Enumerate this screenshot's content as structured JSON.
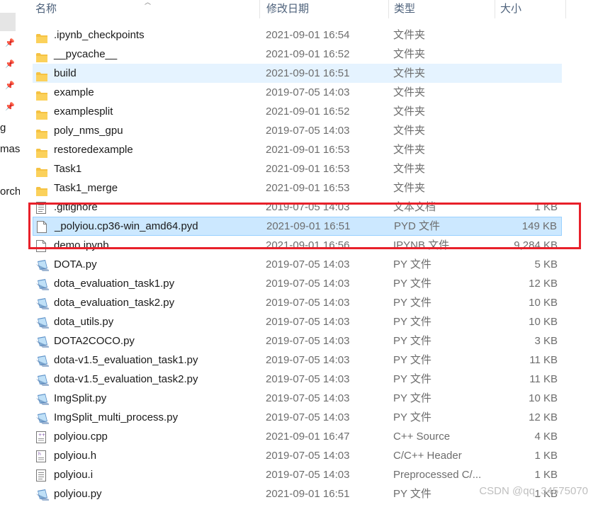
{
  "columns": {
    "name": "名称",
    "modified": "修改日期",
    "type": "类型",
    "size": "大小"
  },
  "nav_fragments": [
    "g",
    "mas",
    "orch"
  ],
  "files": [
    {
      "name": ".ipynb_checkpoints",
      "modified": "2021-09-01 16:54",
      "type": "文件夹",
      "size": "",
      "icon": "folder-icon",
      "state": ""
    },
    {
      "name": "__pycache__",
      "modified": "2021-09-01 16:52",
      "type": "文件夹",
      "size": "",
      "icon": "folder-icon",
      "state": ""
    },
    {
      "name": "build",
      "modified": "2021-09-01 16:51",
      "type": "文件夹",
      "size": "",
      "icon": "folder-icon",
      "state": "hover"
    },
    {
      "name": "example",
      "modified": "2019-07-05 14:03",
      "type": "文件夹",
      "size": "",
      "icon": "folder-icon",
      "state": ""
    },
    {
      "name": "examplesplit",
      "modified": "2021-09-01 16:52",
      "type": "文件夹",
      "size": "",
      "icon": "folder-icon",
      "state": ""
    },
    {
      "name": "poly_nms_gpu",
      "modified": "2019-07-05 14:03",
      "type": "文件夹",
      "size": "",
      "icon": "folder-icon",
      "state": ""
    },
    {
      "name": "restoredexample",
      "modified": "2021-09-01 16:53",
      "type": "文件夹",
      "size": "",
      "icon": "folder-icon",
      "state": ""
    },
    {
      "name": "Task1",
      "modified": "2021-09-01 16:53",
      "type": "文件夹",
      "size": "",
      "icon": "folder-icon",
      "state": ""
    },
    {
      "name": "Task1_merge",
      "modified": "2021-09-01 16:53",
      "type": "文件夹",
      "size": "",
      "icon": "folder-icon",
      "state": ""
    },
    {
      "name": ".gitignore",
      "modified": "2019-07-05 14:03",
      "type": "文本文档",
      "size": "1 KB",
      "icon": "text-file-icon",
      "state": ""
    },
    {
      "name": "_polyiou.cp36-win_amd64.pyd",
      "modified": "2021-09-01 16:51",
      "type": "PYD 文件",
      "size": "149 KB",
      "icon": "file-icon",
      "state": "selected"
    },
    {
      "name": "demo.ipynb",
      "modified": "2021-09-01 16:56",
      "type": "IPYNB 文件",
      "size": "9,284 KB",
      "icon": "file-icon",
      "state": ""
    },
    {
      "name": "DOTA.py",
      "modified": "2019-07-05 14:03",
      "type": "PY 文件",
      "size": "5 KB",
      "icon": "python-file-icon",
      "state": ""
    },
    {
      "name": "dota_evaluation_task1.py",
      "modified": "2019-07-05 14:03",
      "type": "PY 文件",
      "size": "12 KB",
      "icon": "python-file-icon",
      "state": ""
    },
    {
      "name": "dota_evaluation_task2.py",
      "modified": "2019-07-05 14:03",
      "type": "PY 文件",
      "size": "10 KB",
      "icon": "python-file-icon",
      "state": ""
    },
    {
      "name": "dota_utils.py",
      "modified": "2019-07-05 14:03",
      "type": "PY 文件",
      "size": "10 KB",
      "icon": "python-file-icon",
      "state": ""
    },
    {
      "name": "DOTA2COCO.py",
      "modified": "2019-07-05 14:03",
      "type": "PY 文件",
      "size": "3 KB",
      "icon": "python-file-icon",
      "state": ""
    },
    {
      "name": "dota-v1.5_evaluation_task1.py",
      "modified": "2019-07-05 14:03",
      "type": "PY 文件",
      "size": "11 KB",
      "icon": "python-file-icon",
      "state": ""
    },
    {
      "name": "dota-v1.5_evaluation_task2.py",
      "modified": "2019-07-05 14:03",
      "type": "PY 文件",
      "size": "11 KB",
      "icon": "python-file-icon",
      "state": ""
    },
    {
      "name": "ImgSplit.py",
      "modified": "2019-07-05 14:03",
      "type": "PY 文件",
      "size": "10 KB",
      "icon": "python-file-icon",
      "state": ""
    },
    {
      "name": "ImgSplit_multi_process.py",
      "modified": "2019-07-05 14:03",
      "type": "PY 文件",
      "size": "12 KB",
      "icon": "python-file-icon",
      "state": ""
    },
    {
      "name": "polyiou.cpp",
      "modified": "2021-09-01 16:47",
      "type": "C++ Source",
      "size": "4 KB",
      "icon": "cpp-file-icon",
      "state": ""
    },
    {
      "name": "polyiou.h",
      "modified": "2019-07-05 14:03",
      "type": "C/C++ Header",
      "size": "1 KB",
      "icon": "header-file-icon",
      "state": ""
    },
    {
      "name": "polyiou.i",
      "modified": "2019-07-05 14:03",
      "type": "Preprocessed C/...",
      "size": "1 KB",
      "icon": "text-file-icon",
      "state": ""
    },
    {
      "name": "polyiou.py",
      "modified": "2021-09-01 16:51",
      "type": "PY 文件",
      "size": "1 KB",
      "icon": "python-file-icon",
      "state": ""
    }
  ],
  "watermark": "CSDN @qq_34575070",
  "colors": {
    "selected_bg": "#cce8ff",
    "hover_bg": "#e5f3ff",
    "highlight_box": "#e8202a",
    "folder": "#f7c64a"
  }
}
